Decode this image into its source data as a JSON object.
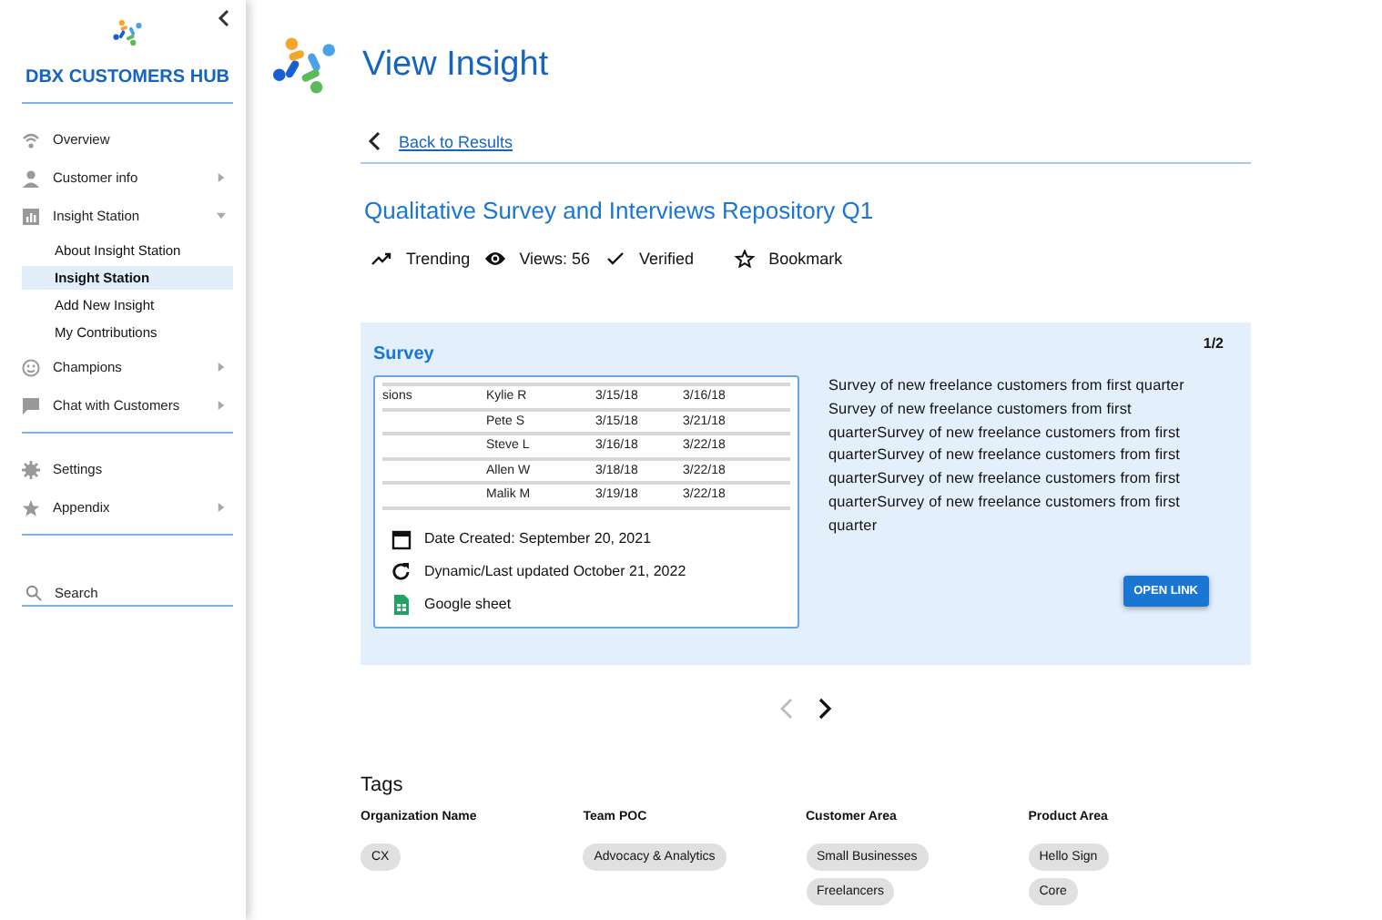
{
  "sidebar": {
    "title": "DBX CUSTOMERS HUB",
    "groups": [
      [
        {
          "label": "Overview",
          "has_submenu": false
        },
        {
          "label": "Customer info",
          "has_submenu": true,
          "expanded": false
        },
        {
          "label": "Insight Station",
          "has_submenu": true,
          "expanded": true,
          "children": [
            {
              "label": "About Insight Station",
              "selected": false
            },
            {
              "label": "Insight Station",
              "selected": true
            },
            {
              "label": "Add New Insight",
              "selected": false
            },
            {
              "label": "My Contributions",
              "selected": false
            }
          ]
        },
        {
          "label": "Champions",
          "has_submenu": true,
          "expanded": false
        },
        {
          "label": "Chat with Customers",
          "has_submenu": true,
          "expanded": false
        }
      ],
      [
        {
          "label": "Settings",
          "has_submenu": false
        },
        {
          "label": "Appendix",
          "has_submenu": true,
          "expanded": false
        }
      ]
    ],
    "search": {
      "placeholder": "Search"
    }
  },
  "page_title": "View Insight",
  "back_link": "Back to Results",
  "insight": {
    "title": "Qualitative Survey and Interviews Repository Q1",
    "meta": [
      {
        "label": "Trending"
      },
      {
        "label": "Views: 56"
      },
      {
        "label": "Verified"
      },
      {
        "label": "Bookmark"
      }
    ]
  },
  "card": {
    "title": "Survey",
    "counter": "1/2",
    "preview_rows": [
      [
        "sions",
        "Kylie R",
        "3/15/18",
        "3/16/18"
      ],
      [
        "",
        "Pete S",
        "3/15/18",
        "3/21/18"
      ],
      [
        "",
        "Steve L",
        "3/16/18",
        "3/22/18"
      ],
      [
        "",
        "Allen W",
        "3/18/18",
        "3/22/18"
      ],
      [
        "",
        "Malik M",
        "3/19/18",
        "3/22/18"
      ]
    ],
    "details": [
      "Date Created: September 20, 2021",
      "Dynamic/Last updated October 21, 2022",
      "Google sheet"
    ],
    "description": "Survey of new freelance customers from first quarter Survey of new freelance customers from first quarterSurvey of new freelance customers from first quarterSurvey of new freelance customers from first quarterSurvey of new freelance customers from first quarterSurvey of new freelance customers from first quarter",
    "button": "OPEN LINK"
  },
  "pager": {
    "prev_disabled": true,
    "next_disabled": false
  },
  "tags": {
    "title": "Tags",
    "columns": [
      {
        "heading": "Organization Name",
        "chips": [
          "CX"
        ]
      },
      {
        "heading": "Team POC",
        "chips": [
          "Advocacy & Analytics"
        ]
      },
      {
        "heading": "Customer Area",
        "chips": [
          "Small Businesses",
          "Freelancers"
        ]
      },
      {
        "heading": "Product Area",
        "chips": [
          "Hello Sign",
          "Core"
        ]
      }
    ]
  }
}
